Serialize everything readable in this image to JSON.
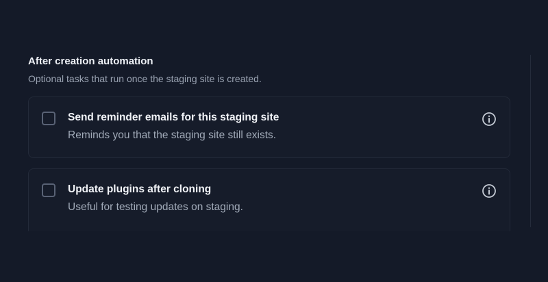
{
  "section": {
    "title": "After creation automation",
    "description": "Optional tasks that run once the staging site is created."
  },
  "options": [
    {
      "title": "Send reminder emails for this staging site",
      "description": "Reminds you that the staging site still exists.",
      "checked": false,
      "icon": "info-icon"
    },
    {
      "title": "Update plugins after cloning",
      "description": "Useful for testing updates on staging.",
      "checked": false,
      "icon": "info-icon"
    }
  ],
  "colors": {
    "background": "#141a28",
    "card_border": "#232a39",
    "title": "#eef1f6",
    "muted": "#9aa3b2",
    "icon": "#c6ccd6"
  }
}
